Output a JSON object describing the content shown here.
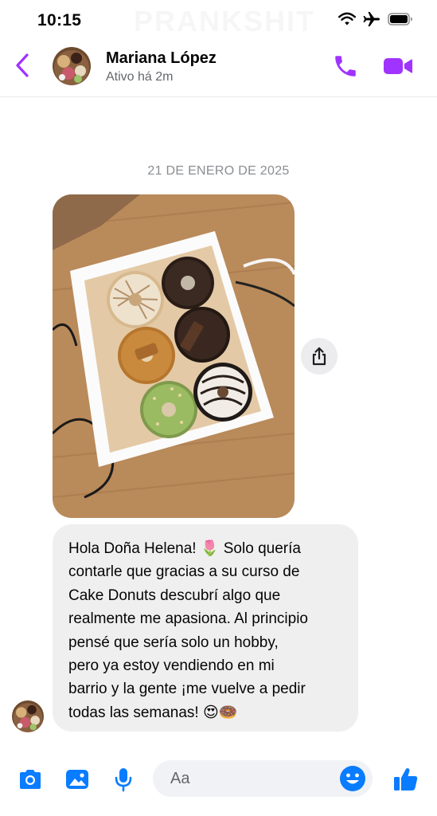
{
  "status_bar": {
    "time": "10:15"
  },
  "watermark": {
    "text": "PRANKSHIT"
  },
  "header": {
    "contact_name": "Mariana López",
    "contact_status": "Ativo há 2m"
  },
  "conversation": {
    "date_separator": "21 DE ENERO DE 2025",
    "message_lines": [
      "Hola Doña Helena! 🌷 Solo quería",
      "contarle que gracias a su curso de",
      "Cake Donuts descubrí algo que",
      "realmente me apasiona. Al principio",
      "pensé que sería solo un hobby,",
      "pero ya estoy vendiendo en mi",
      "barrio y la gente ¡me vuelve a pedir",
      "todas las semanas! 😍🍩"
    ]
  },
  "composer": {
    "placeholder": "Aa"
  },
  "colors": {
    "accent": "#a033ff",
    "blue": "#0a7cff",
    "bubble": "#efefef"
  },
  "icons": [
    "back-chevron-icon",
    "phone-icon",
    "video-camera-icon",
    "share-icon",
    "camera-icon",
    "gallery-icon",
    "microphone-icon",
    "smiley-icon",
    "thumbs-up-icon",
    "wifi-icon",
    "airplane-icon",
    "battery-icon"
  ]
}
